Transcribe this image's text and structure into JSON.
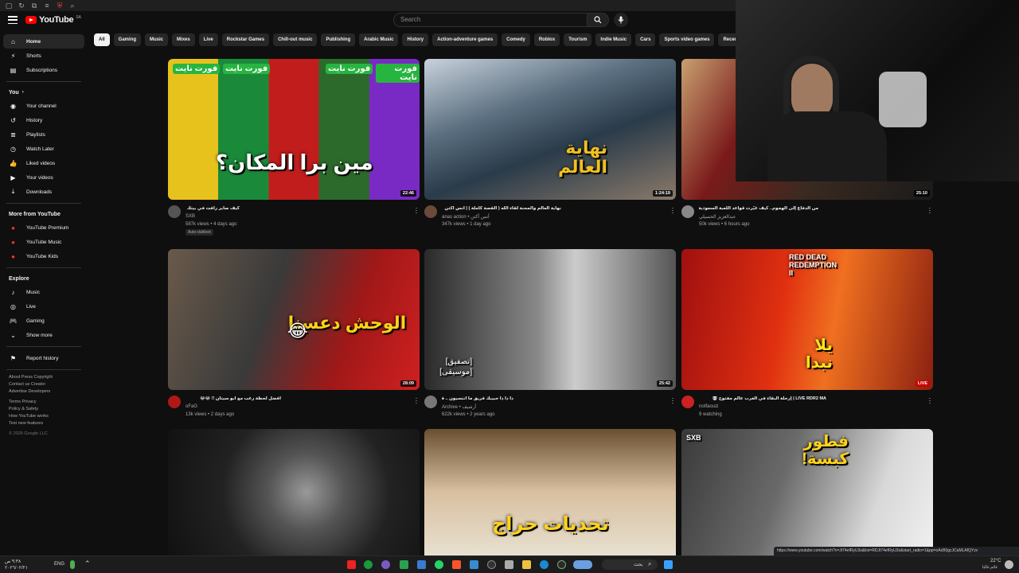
{
  "app": {
    "name": "YouTube",
    "country": "SA"
  },
  "search": {
    "placeholder": "Search"
  },
  "sidebar": {
    "main": [
      {
        "label": "Home",
        "icon": "home-icon"
      },
      {
        "label": "Shorts",
        "icon": "shorts-icon"
      },
      {
        "label": "Subscriptions",
        "icon": "subscriptions-icon"
      }
    ],
    "you_header": "You",
    "you": [
      {
        "label": "Your channel",
        "icon": "channel-icon"
      },
      {
        "label": "History",
        "icon": "history-icon"
      },
      {
        "label": "Playlists",
        "icon": "playlists-icon"
      },
      {
        "label": "Watch Later",
        "icon": "watch-later-icon"
      },
      {
        "label": "Liked videos",
        "icon": "like-icon"
      },
      {
        "label": "Your videos",
        "icon": "your-videos-icon"
      },
      {
        "label": "Downloads",
        "icon": "download-icon"
      }
    ],
    "more_header": "More from YouTube",
    "more": [
      {
        "label": "YouTube Premium"
      },
      {
        "label": "YouTube Music"
      },
      {
        "label": "YouTube Kids"
      }
    ],
    "explore_header": "Explore",
    "explore": [
      {
        "label": "Music",
        "icon": "music-icon"
      },
      {
        "label": "Live",
        "icon": "live-icon"
      },
      {
        "label": "Gaming",
        "icon": "gaming-icon"
      },
      {
        "label": "Show more",
        "icon": "chevron-down-icon"
      }
    ],
    "report": "Report history",
    "footer1": "About Press Copyright",
    "footer2": "Contact us Creator",
    "footer3": "Advertise Developers",
    "footer4": "Terms Privacy",
    "footer5": "Policy & Safety",
    "footer6": "How YouTube works",
    "footer7": "Test new features",
    "copyright": "© 2026 Google LLC"
  },
  "chips": [
    "All",
    "Gaming",
    "Music",
    "Mixes",
    "Live",
    "Rockstar Games",
    "Chill-out music",
    "Publishing",
    "Arabic Music",
    "History",
    "Action-adventure games",
    "Comedy",
    "Roblox",
    "Tourism",
    "Indie Music",
    "Cars",
    "Sports video games",
    "Recently uploaded"
  ],
  "videos": [
    {
      "title": "كيف صاير رافت في بيتك ..!؟",
      "channel": "SXB",
      "stats": "587k views • 4 days ago",
      "badge": "Auto-dubbed",
      "duration": "22:46",
      "overlay": "مين برا المكان؟",
      "tag": "فورت نايت"
    },
    {
      "title": "نهاية العالم والمحنة لقاء الله ( القصة كاملة ) | أنس أكتن",
      "channel": "anas action • أنس أكتن",
      "stats": "347k views • 1 day ago",
      "duration": "1:24:19",
      "overlay": "نهاية العالم"
    },
    {
      "title": "من الدفاع إلى الهجوم.. كيف غيّرت قواعد اللعبة السعودية؟",
      "channel": "عبدالعزيز الحسيلي",
      "stats": "50k views • 6 hours ago",
      "duration": "25:10"
    },
    {
      "title": "افضل لحظة رعب مع ابو سيتان !! 😂😂",
      "channel": "oFaG",
      "stats": "13k views • 2 days ago",
      "duration": "28:09",
      "overlay": "الوحش دعسنا"
    },
    {
      "title": "ذا ذا ذا حبيبك فريق ما انتسيون .. فرق",
      "channel": "Archive • أرشيف",
      "stats": "622k views • 2 years ago",
      "duration": "25:42",
      "overlay": "[تصفيق] [موسيقى]"
    },
    {
      "title": "LIVE RDR2 MA | إرحلة البقاء في الغرب عالم مفتوح 💀",
      "channel": "notfaouzi",
      "stats": "9 watching",
      "live": "LIVE",
      "overlay": "يلا نبدا",
      "game": "RED DEAD REDEMPTION II"
    },
    {
      "title": "",
      "channel": "",
      "stats": ""
    },
    {
      "title": "",
      "channel": "",
      "stats": "",
      "overlay": "تحديات حراج"
    },
    {
      "title": "",
      "channel": "",
      "stats": "",
      "overlay": "فطور كبسة!",
      "brand": "SXB"
    }
  ],
  "status_url": "https://www.youtube.com/watch?v=Jt74efRyU3s&list=RDJt74efRyU3s&start_radio=1&pp=oAcB0gcJCaMLAfQYzv",
  "taskbar": {
    "lang": "ENG",
    "temp": "22°C",
    "weather": "غائم غالبا",
    "search": "بحث",
    "time": "٩:٣٨ ص",
    "date": "٢٠٢٦/٠٢/٢١"
  },
  "colors": {
    "accent": "#ff0000",
    "bg": "#0f0f0f",
    "chip": "#272727"
  }
}
